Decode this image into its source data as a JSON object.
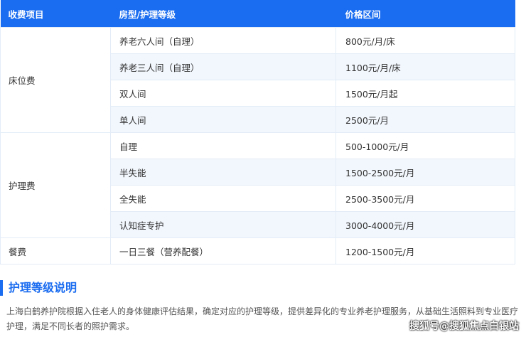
{
  "table": {
    "headers": [
      "收费项目",
      "房型/护理等级",
      "价格区间"
    ],
    "groups": [
      {
        "category": "床位费",
        "rows": [
          {
            "type": "养老六人间（自理）",
            "price": "800元/月/床"
          },
          {
            "type": "养老三人间（自理）",
            "price": "1100元/月/床"
          },
          {
            "type": "双人间",
            "price": "1500元/月起"
          },
          {
            "type": "单人间",
            "price": "2500元/月"
          }
        ]
      },
      {
        "category": "护理费",
        "rows": [
          {
            "type": "自理",
            "price": "500-1000元/月"
          },
          {
            "type": "半失能",
            "price": "1500-2500元/月"
          },
          {
            "type": "全失能",
            "price": "2500-3500元/月"
          },
          {
            "type": "认知症专护",
            "price": "3000-4000元/月"
          }
        ]
      },
      {
        "category": "餐费",
        "rows": [
          {
            "type": "一日三餐（营养配餐）",
            "price": "1200-1500元/月"
          }
        ]
      }
    ]
  },
  "section": {
    "title": "护理等级说明",
    "description": "上海白鹤养护院根据入住老人的身体健康评估结果，确定对应的护理等级，提供差异化的专业养老护理服务，从基础生活照料到专业医疗护理，满足不同长者的照护需求。"
  },
  "watermark": "搜狐号@搜狐焦点白银站",
  "colors": {
    "accent": "#1a6cf0",
    "header_text": "#ffffff",
    "row_alt": "#f2f7fd"
  }
}
